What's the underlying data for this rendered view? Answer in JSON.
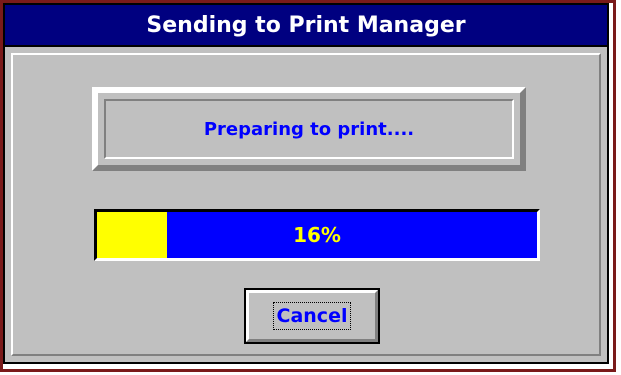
{
  "window": {
    "title": "Sending to Print Manager"
  },
  "status": {
    "message": "Preparing to print...."
  },
  "progress": {
    "value": 0.16,
    "label": "16%",
    "fill_color": "#ffff00",
    "track_color": "#0000ff"
  },
  "buttons": {
    "cancel_label": "Cancel"
  },
  "colors": {
    "titlebar": "#000080",
    "title_text": "#ffffff",
    "accent_text": "#0000ff",
    "face": "#c0c0c0"
  }
}
